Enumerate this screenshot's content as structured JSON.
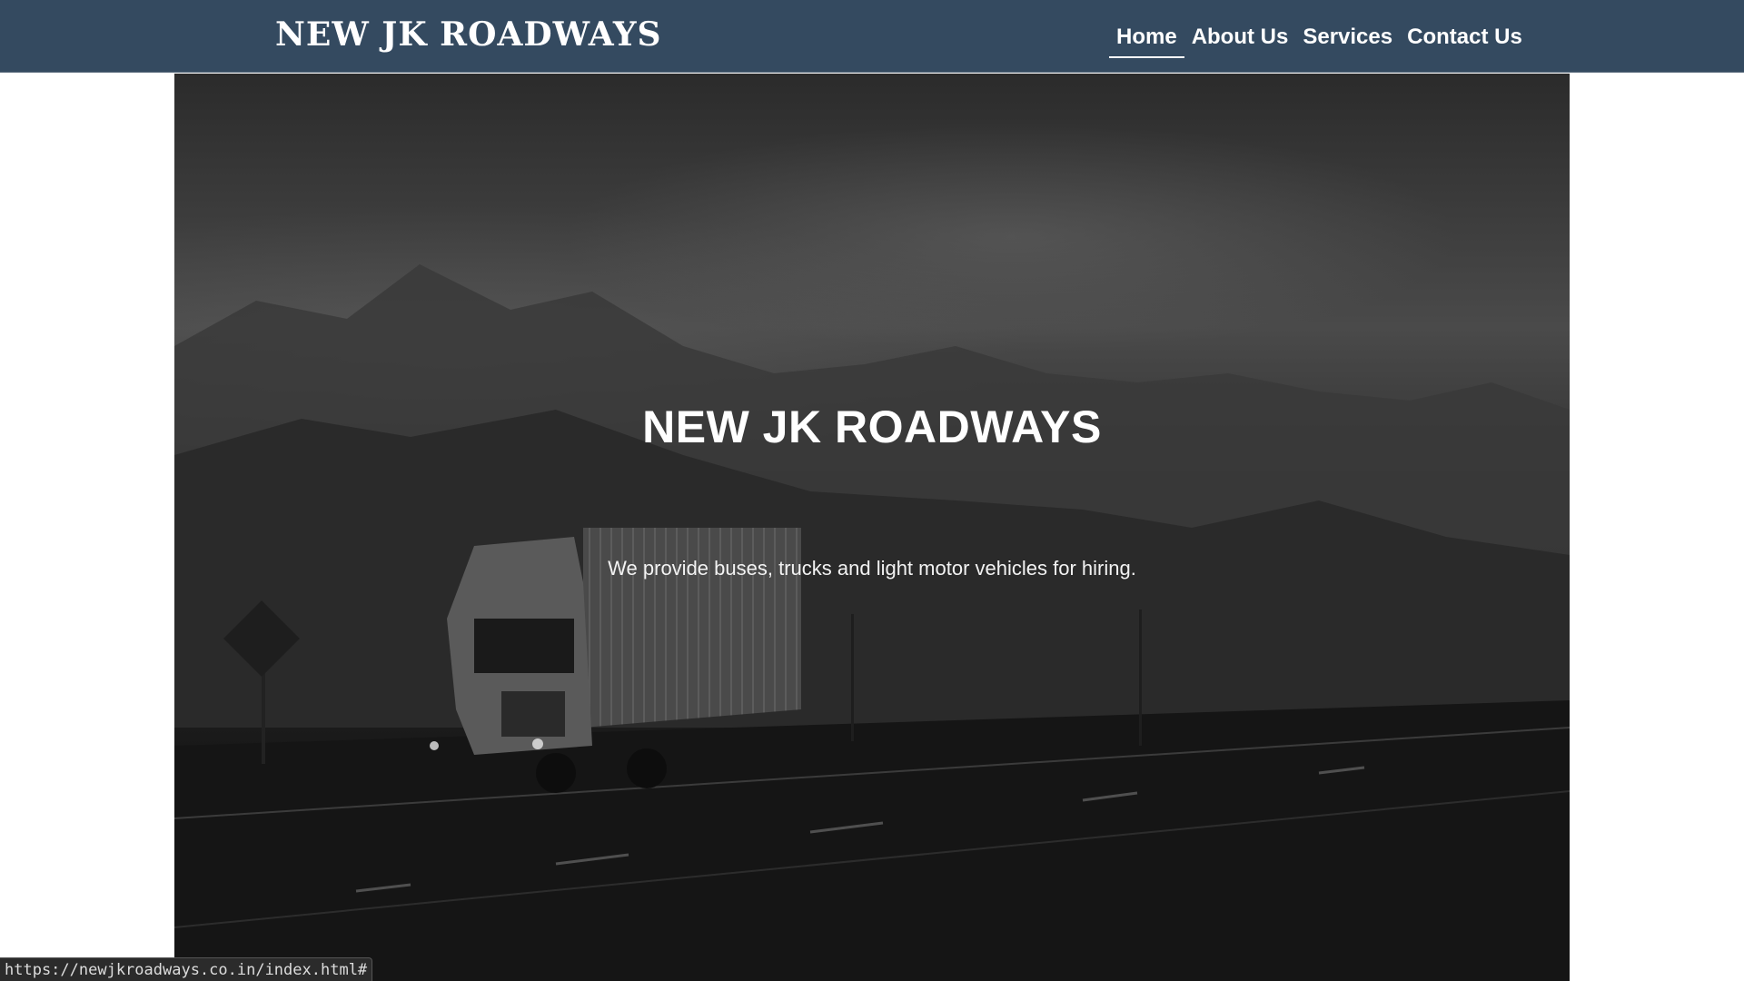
{
  "navbar": {
    "brand": "NEW JK ROADWAYS",
    "links": [
      {
        "label": "Home",
        "active": true
      },
      {
        "label": "About Us",
        "active": false
      },
      {
        "label": "Services",
        "active": false
      },
      {
        "label": "Contact Us",
        "active": false
      }
    ],
    "background": "#344a60"
  },
  "hero": {
    "title": "NEW JK ROADWAYS",
    "subtitle": "We provide buses, trucks and light motor vehicles for hiring."
  },
  "status_bar": {
    "url": "https://newjkroadways.co.in/index.html#"
  }
}
